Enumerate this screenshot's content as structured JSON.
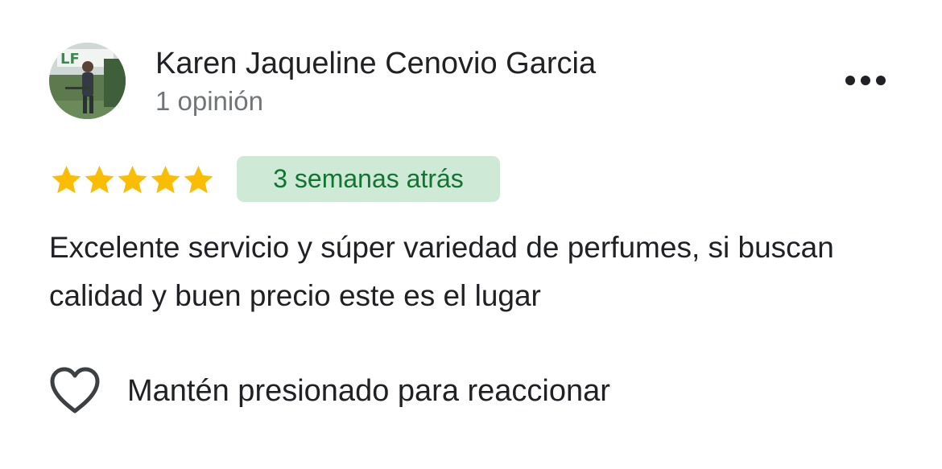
{
  "reviewer": {
    "name": "Karen Jaqueline Cenovio Garcia",
    "review_count": "1 opinión",
    "avatar": "user-photo"
  },
  "menu": {
    "icon": "more-horizontal-icon"
  },
  "review": {
    "rating": 5,
    "rating_max": 5,
    "star_color": "#fbbc04",
    "time_ago": "3 semanas atrás",
    "time_badge_bg": "#ceead6",
    "time_badge_text_color": "#137333",
    "text": "Excelente servicio y súper variedad de perfumes, si buscan calidad y buen precio este es el lugar"
  },
  "reaction": {
    "icon": "heart-outline-icon",
    "label": "Mantén presionado para reaccionar"
  }
}
